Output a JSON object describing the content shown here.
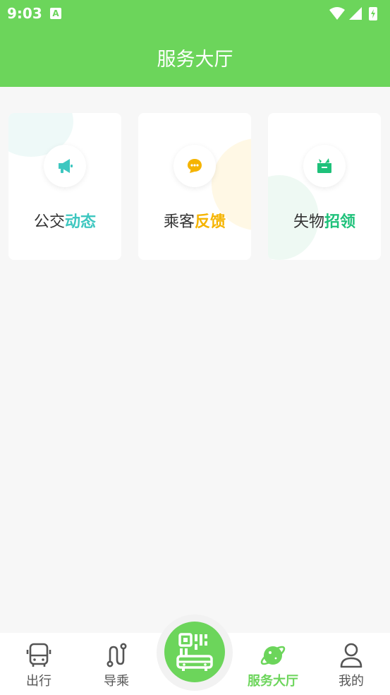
{
  "status_bar": {
    "time": "9:03",
    "notif_icon": "A"
  },
  "header": {
    "title": "服务大厅"
  },
  "cards": [
    {
      "label_plain": "公交",
      "label_highlight": "动态",
      "icon": "megaphone-icon",
      "accent": "#3ec7c0"
    },
    {
      "label_plain": "乘客",
      "label_highlight": "反馈",
      "icon": "chat-bubble-icon",
      "accent": "#f5b400"
    },
    {
      "label_plain": "失物",
      "label_highlight": "招领",
      "icon": "lost-box-icon",
      "accent": "#1ec17a"
    }
  ],
  "tabbar": {
    "tabs": [
      {
        "label": "出行",
        "icon": "bus-icon"
      },
      {
        "label": "导乘",
        "icon": "route-icon"
      },
      {
        "label": "服务大厅",
        "icon": "planet-icon",
        "active": true
      },
      {
        "label": "我的",
        "icon": "user-icon"
      }
    ],
    "center_icon": "qr-scan-icon"
  },
  "colors": {
    "brand": "#6cd55b",
    "background": "#f7f7f7"
  }
}
